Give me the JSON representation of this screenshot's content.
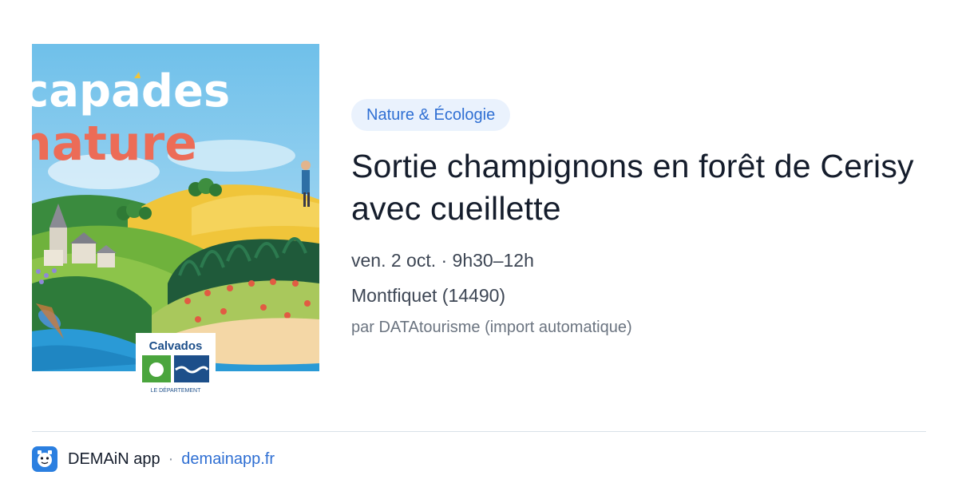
{
  "poster": {
    "title_line1": "capades",
    "title_line2": "nature",
    "logo_name": "Calvados",
    "logo_sub": "LE DÉPARTEMENT"
  },
  "event": {
    "category": "Nature & Écologie",
    "title": "Sortie champignons en forêt de Cerisy avec cueillette",
    "date_time": "ven. 2 oct. · 9h30–12h",
    "location": "Montfiquet (14490)",
    "source": "par DATAtourisme (import automatique)"
  },
  "footer": {
    "app_name": "DEMAiN app",
    "separator": "·",
    "url": "demainapp.fr",
    "icon": "demain-app-icon"
  },
  "colors": {
    "accent": "#2f6fd3",
    "pill_bg": "#eaf2fd",
    "title": "#151d2c",
    "meta": "#3d4654",
    "muted": "#6b7480"
  }
}
